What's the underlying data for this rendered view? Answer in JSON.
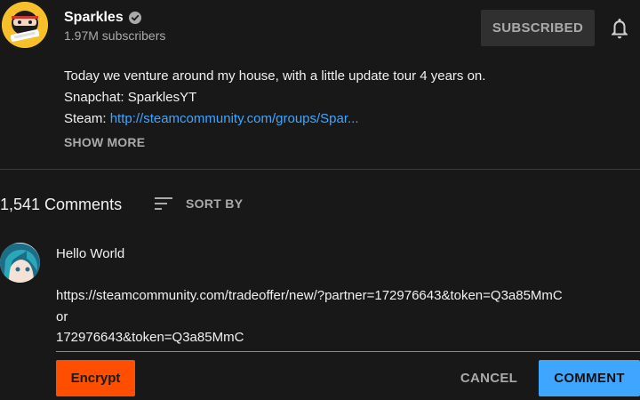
{
  "channel": {
    "name": "Sparkles",
    "subscribers": "1.97M subscribers",
    "subscribe_label": "SUBSCRIBED",
    "avatar_icon": "ninja-avatar-icon",
    "verified_icon": "verified-check-icon",
    "bell_icon": "bell-icon"
  },
  "description": {
    "line1": "Today we venture around my house, with a little update tour 4 years on.",
    "line2": "Snapchat: SparklesYT",
    "line3_prefix": "Steam: ",
    "line3_link": "http://steamcommunity.com/groups/Spar...",
    "show_more": "SHOW MORE"
  },
  "comments": {
    "count": "1,541 Comments",
    "sort_label": "SORT BY",
    "sort_icon": "sort-lines-icon"
  },
  "comment_box": {
    "avatar_icon": "user-anime-avatar-icon",
    "lines": [
      "Hello World",
      "",
      "https://steamcommunity.com/tradeoffer/new/?partner=172976643&token=Q3a85MmC",
      "or",
      "172976643&token=Q3a85MmC"
    ],
    "encrypt_label": "Encrypt",
    "cancel_label": "CANCEL",
    "comment_label": "COMMENT"
  },
  "colors": {
    "background": "#181818",
    "link": "#3ea6ff",
    "encrypt": "#ff4e00",
    "comment_button": "#3ea6ff"
  }
}
